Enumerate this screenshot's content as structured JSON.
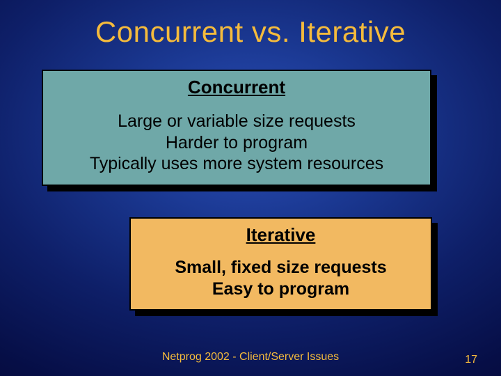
{
  "title": "Concurrent vs. Iterative",
  "panel1": {
    "heading": "Concurrent",
    "line1": "Large or variable size requests",
    "line2": "Harder to program",
    "line3": "Typically uses more system resources"
  },
  "panel2": {
    "heading": "Iterative",
    "line1": "Small, fixed size requests",
    "line2": "Easy to program"
  },
  "footer": "Netprog 2002 - Client/Server Issues",
  "page": "17"
}
